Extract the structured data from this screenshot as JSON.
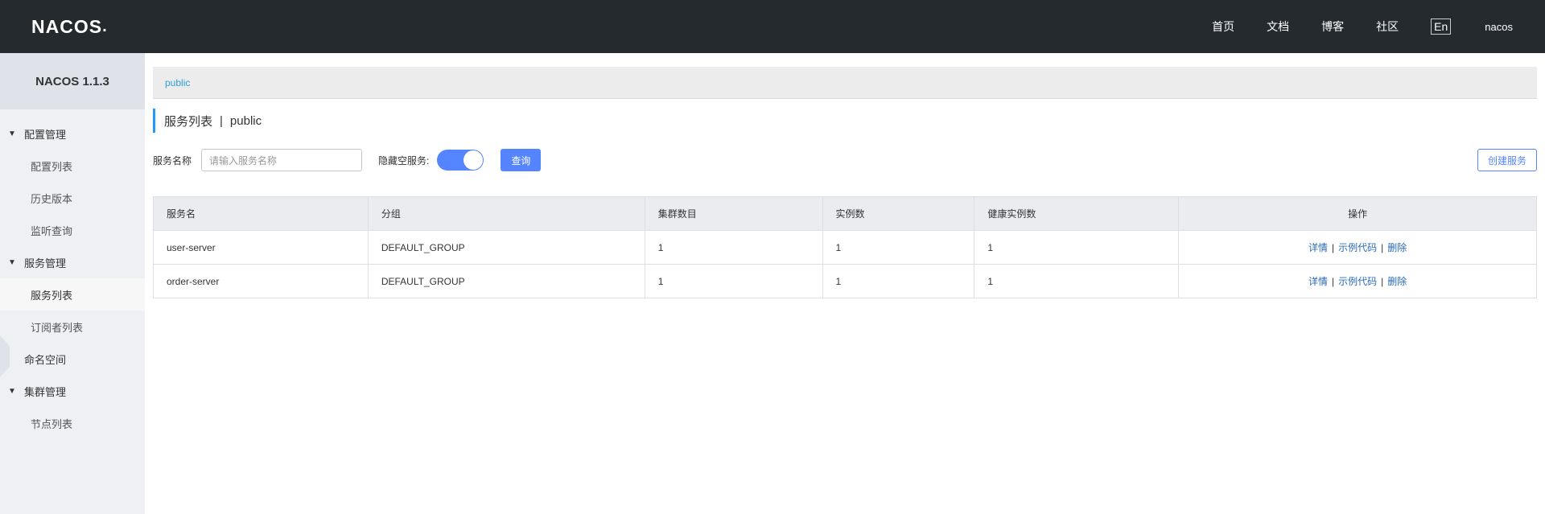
{
  "header": {
    "logo": "NACOS",
    "nav": [
      "首页",
      "文档",
      "博客",
      "社区"
    ],
    "lang": "En",
    "user": "nacos"
  },
  "sidebar": {
    "version": "NACOS 1.1.3",
    "groups": [
      {
        "label": "配置管理",
        "items": [
          "配置列表",
          "历史版本",
          "监听查询"
        ]
      },
      {
        "label": "服务管理",
        "items": [
          "服务列表",
          "订阅者列表"
        ]
      },
      {
        "label": "命名空间"
      },
      {
        "label": "集群管理",
        "items": [
          "节点列表"
        ]
      }
    ],
    "active": "服务列表"
  },
  "breadcrumb": {
    "namespace": "public"
  },
  "page": {
    "title": "服务列表",
    "sep": "|",
    "namespace": "public"
  },
  "filter": {
    "name_label": "服务名称",
    "name_placeholder": "请输入服务名称",
    "hide_empty_label": "隐藏空服务:",
    "hide_empty_on": true,
    "query_label": "查询",
    "create_label": "创建服务"
  },
  "table": {
    "columns": [
      "服务名",
      "分组",
      "集群数目",
      "实例数",
      "健康实例数",
      "操作"
    ],
    "rows": [
      {
        "name": "user-server",
        "group": "DEFAULT_GROUP",
        "clusters": "1",
        "instances": "1",
        "healthy": "1"
      },
      {
        "name": "order-server",
        "group": "DEFAULT_GROUP",
        "clusters": "1",
        "instances": "1",
        "healthy": "1"
      }
    ],
    "ops": {
      "detail": "详情",
      "sample": "示例代码",
      "delete": "删除",
      "sep": "|"
    }
  }
}
